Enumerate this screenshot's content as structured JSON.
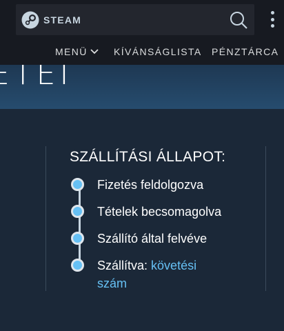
{
  "header": {
    "logo_text": "STEAM",
    "icons": [
      "steam-logo-icon",
      "search-icon",
      "kebab-menu-icon"
    ]
  },
  "nav": {
    "menu_label": "MENÜ",
    "wishlist_label": "KÍVÁNSÁGLISTA",
    "wallet_label": "PÉNZTÁRCA"
  },
  "banner": {
    "partial_title": "ETEI"
  },
  "shipping": {
    "title": "SZÁLLÍTÁSI ÁLLAPOT:",
    "steps": [
      {
        "label": "Fizetés feldolgozva"
      },
      {
        "label": "Tételek becsomagolva"
      },
      {
        "label": "Szállító által felvéve"
      },
      {
        "label": "Szállítva:",
        "link_part1": "követési",
        "link_part2": "szám"
      }
    ]
  },
  "colors": {
    "background": "#1b2838",
    "header": "#171a21",
    "accent": "#66c0f4",
    "text": "#ffffff"
  }
}
